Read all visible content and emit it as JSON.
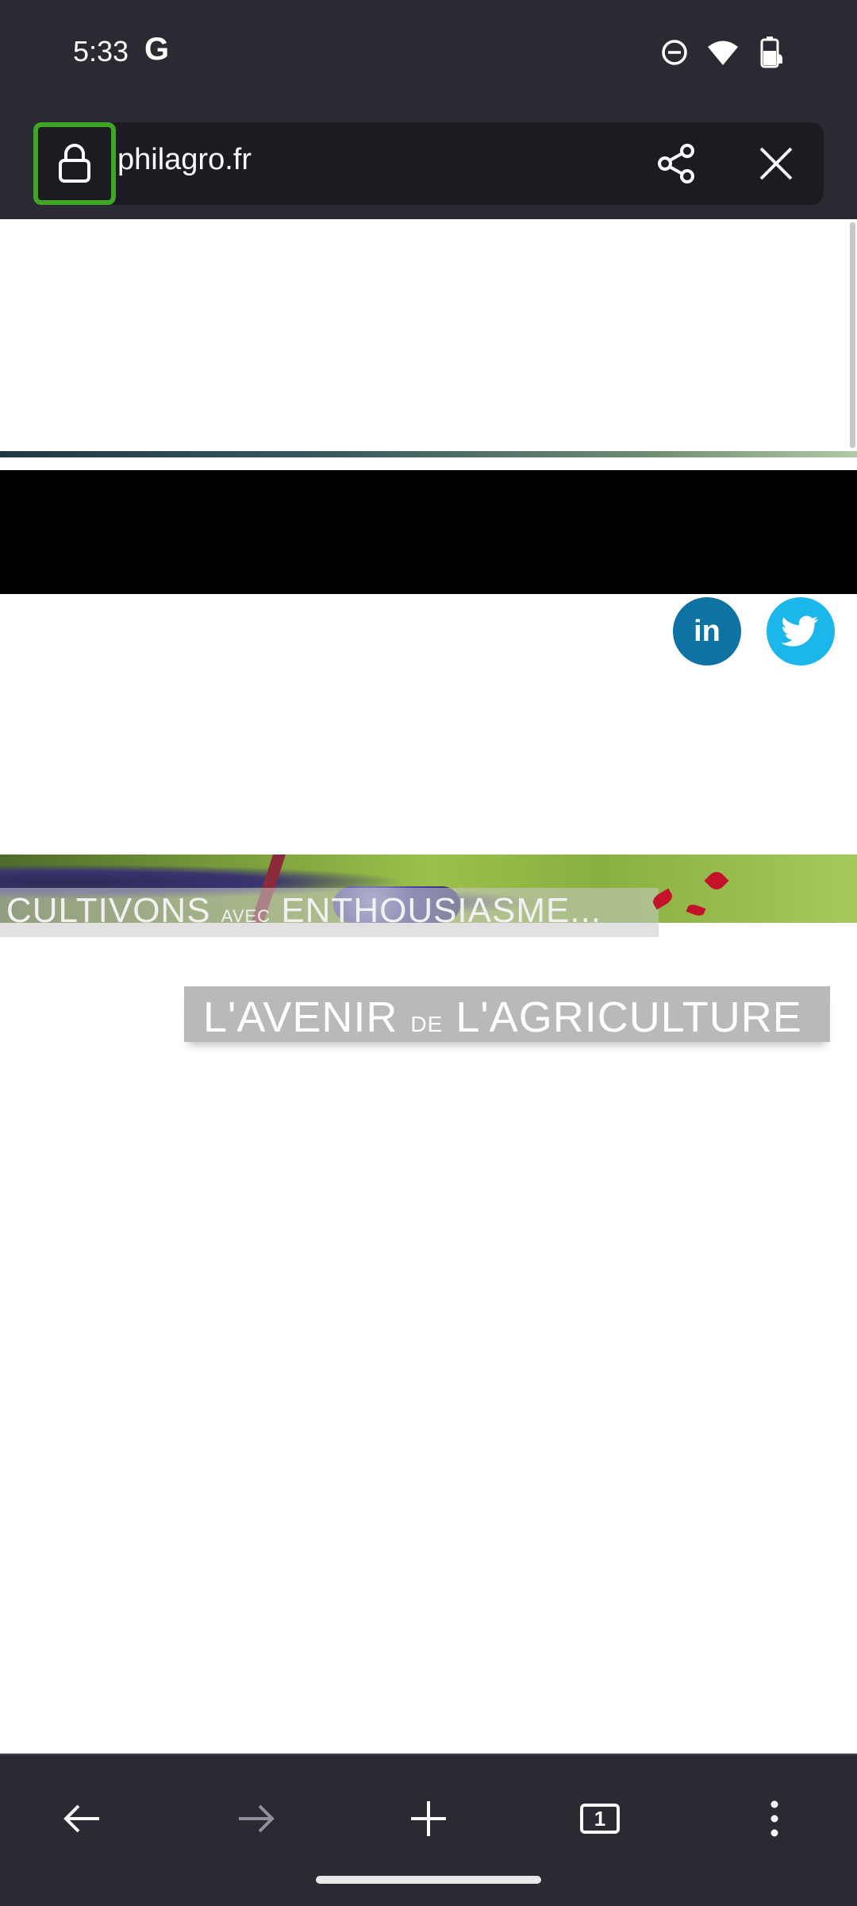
{
  "status_bar": {
    "time": "5:33",
    "google_glyph": "G",
    "icons": [
      "do-not-disturb-icon",
      "wifi-icon",
      "battery-icon"
    ]
  },
  "toolbar": {
    "url": "philagro.fr",
    "lock_icon": "lock-icon",
    "share_icon": "share-icon",
    "close_icon": "close-icon",
    "load_progress": 0.8
  },
  "page": {
    "social": {
      "linkedin_label": "in",
      "twitter_icon": "twitter-bird-icon"
    },
    "banner": {
      "word1": "CULTIVONS",
      "word2": "AVEC",
      "word3": "ENTHOUSIASME..."
    },
    "tagline": {
      "part1": "L'AVENIR",
      "part2": "DE",
      "part3": "L'AGRICULTURE"
    }
  },
  "bottom_nav": {
    "tab_count": "1",
    "icons": [
      "back-arrow-icon",
      "forward-arrow-icon",
      "plus-icon",
      "tabs-icon",
      "more-vert-icon"
    ]
  },
  "colors": {
    "chrome": "#2b2a33",
    "url_field": "#1c1b22",
    "lock_highlight": "#3fa625",
    "linkedin": "#0e73a3",
    "twitter": "#1cb7ea"
  }
}
